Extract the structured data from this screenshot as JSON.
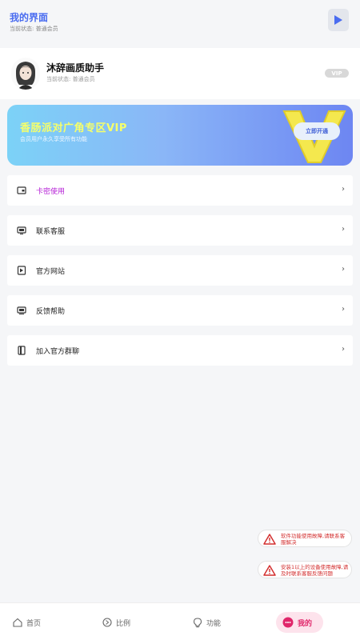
{
  "header": {
    "title": "我的界面",
    "subtitle": "当前状态: 普通会员"
  },
  "profile": {
    "name": "沐辞画质助手",
    "sub": "当前状态: 普通会员",
    "vip_tag": "VIP"
  },
  "banner": {
    "title": "香肠派对广角专区VIP",
    "subtitle": "会员用户永久享受所有功能",
    "button": "立即开通"
  },
  "menu": [
    {
      "label": "卡密使用",
      "icon": "card-icon",
      "color": "#b51fd6"
    },
    {
      "label": "联系客服",
      "icon": "monitor-icon",
      "color": "#222222"
    },
    {
      "label": "官方网站",
      "icon": "window-icon",
      "color": "#222222"
    },
    {
      "label": "反馈帮助",
      "icon": "feedback-icon",
      "color": "#222222"
    },
    {
      "label": "加入官方群聊",
      "icon": "book-icon",
      "color": "#222222"
    }
  ],
  "notices": [
    {
      "text": "软件功能使用故障,请联系客服解决",
      "icon": "warning-icon"
    },
    {
      "text": "安装1以上的设备使用故障,请及时联系客服反馈问题",
      "icon": "warning-icon"
    }
  ],
  "tabs": [
    {
      "label": "首页",
      "icon": "home-icon"
    },
    {
      "label": "比例",
      "icon": "ratio-icon"
    },
    {
      "label": "功能",
      "icon": "bulb-icon"
    },
    {
      "label": "我的",
      "icon": "user-icon",
      "active": true
    }
  ],
  "colors": {
    "accent": "#4a6cf0",
    "active_tab": "#e0266a",
    "banner_title": "#f6ff6a",
    "warning": "#d32f2f"
  }
}
